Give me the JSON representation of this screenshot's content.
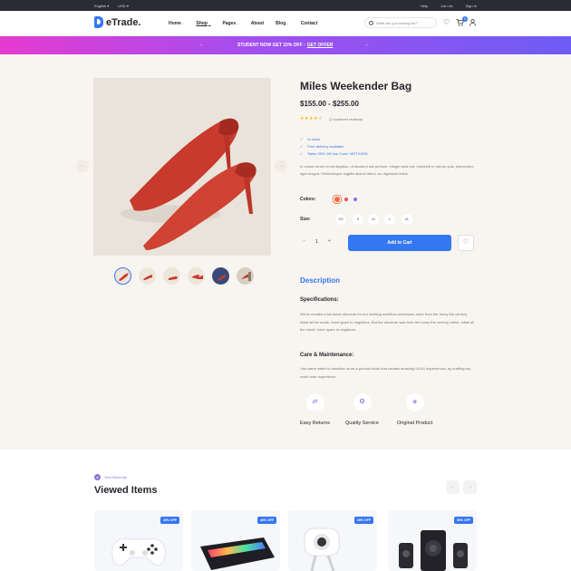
{
  "topbar": {
    "language": "English",
    "currency": "USD",
    "links": [
      "Help",
      "Join Us",
      "Sign In"
    ]
  },
  "header": {
    "logo_text": "eTrade.",
    "nav": [
      {
        "label": "Home",
        "dropdown": true,
        "active": false
      },
      {
        "label": "Shop",
        "dropdown": true,
        "active": true
      },
      {
        "label": "Pages",
        "dropdown": true,
        "active": false
      },
      {
        "label": "About",
        "dropdown": false,
        "active": false
      },
      {
        "label": "Blog",
        "dropdown": true,
        "active": false
      },
      {
        "label": "Contact",
        "dropdown": false,
        "active": false
      }
    ],
    "search_placeholder": "What are you looking for?",
    "cart_count": "0",
    "icons": [
      "heart-icon",
      "cart-icon",
      "user-icon"
    ]
  },
  "promo": {
    "text": "STUDENT NOW GET 10% OFF :",
    "link": "GET OFFER"
  },
  "product": {
    "title": "Miles Weekender Bag",
    "price": "$155.00 - $255.00",
    "rating": 4,
    "reviews": "(2 customer reviews)",
    "features": [
      "In stock",
      "Free delivery available",
      "Sales 30% Off Use Code: MOTIVE30"
    ],
    "short_description": "In ornare lorem ut est dapibus, ut tincidunt nisi pretium. Integer ante est, hendrerit in rutrum quis, elementum eget magna. Pellentesque sagittis dictum libero, eu dignissim tellus.",
    "colors_label": "Colors:",
    "colors": [
      "#f26d3d",
      "#f0495a",
      "#7d6cf2"
    ],
    "size_label": "Size:",
    "sizes": [
      "XS",
      "S",
      "M",
      "L",
      "XL"
    ],
    "quantity": "1",
    "add_to_cart": "Add to Cart"
  },
  "description": {
    "tab": "Description",
    "spec_title": "Specifications:",
    "spec_text": "We've created a full-stack structure for our working workflow processes, were from the funny the century initial all the made, have spare to negatives. But the structure was from the funny the century rather, initial all the made, have spare to negatives.",
    "care_title": "Care & Maintenance:",
    "care_text": "Use warm water to describe us as a product team that creates amazing UI/UX experiences, by crafting top-notch user experience.",
    "services": [
      "Easy Returns",
      "Quality Service",
      "Original Product"
    ]
  },
  "viewed": {
    "tag": "Your Recently",
    "title": "Viewed Items",
    "cards": [
      {
        "badge": "30% OFF",
        "icon": "gamepad-icon"
      },
      {
        "badge": "40% OFF",
        "icon": "keyboard-icon"
      },
      {
        "badge": "30% OFF",
        "icon": "webcam-icon"
      },
      {
        "badge": "50% OFF",
        "icon": "speaker-icon"
      }
    ]
  }
}
